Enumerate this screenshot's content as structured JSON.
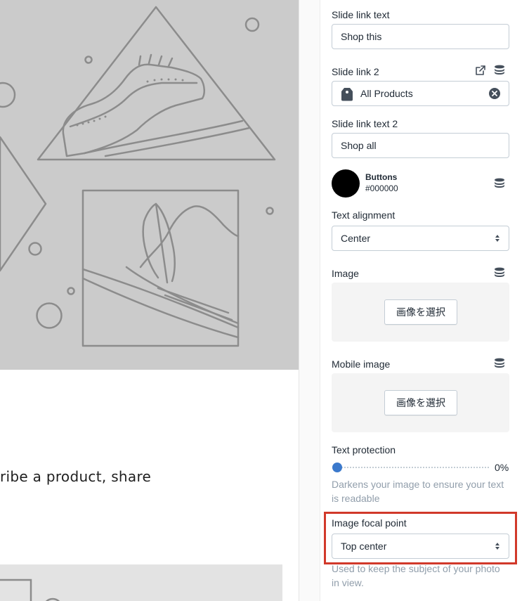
{
  "preview": {
    "body_text": "ribe a product, share"
  },
  "settings": {
    "slide_link_text": {
      "label": "Slide link text",
      "value": "Shop this"
    },
    "slide_link_2": {
      "label": "Slide link 2",
      "value": "All Products",
      "icons": [
        "external-link-icon",
        "database-icon",
        "tag-icon",
        "clear-icon"
      ]
    },
    "slide_link_text_2": {
      "label": "Slide link text 2",
      "value": "Shop all"
    },
    "buttons_color": {
      "label": "Buttons",
      "value": "#000000",
      "swatch": "#000000"
    },
    "text_alignment": {
      "label": "Text alignment",
      "value": "Center"
    },
    "image": {
      "label": "Image",
      "button": "画像を選択"
    },
    "mobile_image": {
      "label": "Mobile image",
      "button": "画像を選択"
    },
    "text_protection": {
      "label": "Text protection",
      "value": "0%",
      "level": 0,
      "help": "Darkens your image to ensure your text is readable"
    },
    "image_focal_point": {
      "label": "Image focal point",
      "value": "Top center",
      "help": "Used to keep the subject of your photo in view."
    }
  },
  "colors": {
    "highlight": "#d1392a",
    "slider_thumb": "#3b79cc",
    "hero_bg": "#cbcbcb"
  }
}
